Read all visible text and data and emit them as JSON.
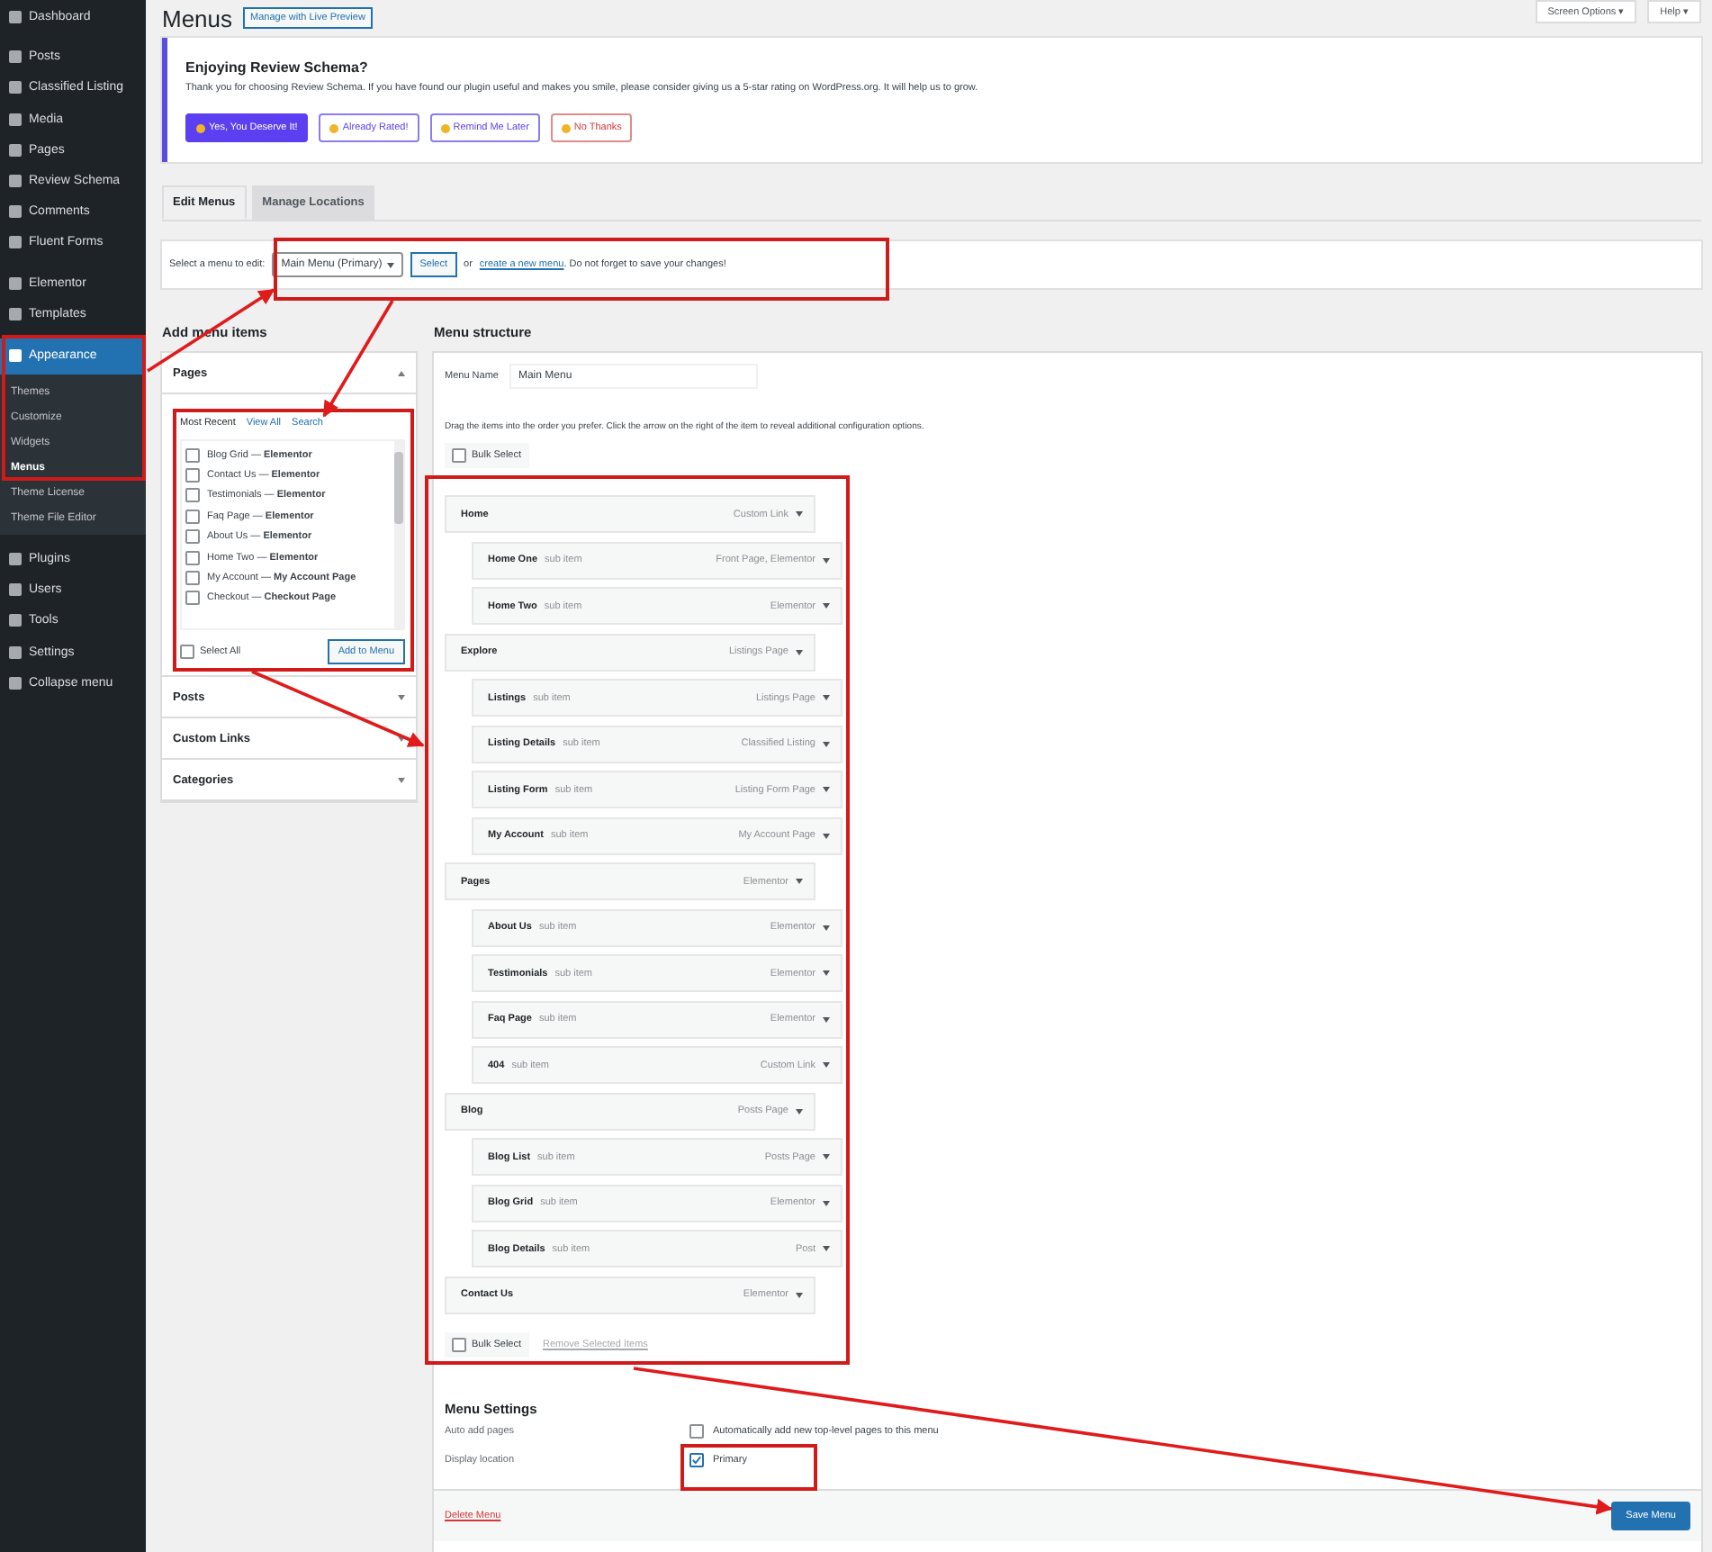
{
  "sidebar": {
    "items": [
      {
        "label": "Dashboard",
        "selected": false
      },
      {
        "label": "Posts",
        "selected": false
      },
      {
        "label": "Classified Listing",
        "selected": false
      },
      {
        "label": "Media",
        "selected": false
      },
      {
        "label": "Pages",
        "selected": false
      },
      {
        "label": "Review Schema",
        "selected": false
      },
      {
        "label": "Comments",
        "selected": false
      },
      {
        "label": "Fluent Forms",
        "selected": false
      },
      {
        "label": "Elementor",
        "selected": false
      },
      {
        "label": "Templates",
        "selected": false
      },
      {
        "label": "Appearance",
        "selected": true,
        "children": [
          {
            "label": "Themes",
            "selected": false
          },
          {
            "label": "Customize",
            "selected": false
          },
          {
            "label": "Widgets",
            "selected": false
          },
          {
            "label": "Menus",
            "selected": true
          },
          {
            "label": "Theme License",
            "selected": false
          },
          {
            "label": "Theme File Editor",
            "selected": false
          }
        ]
      },
      {
        "label": "Plugins",
        "selected": false
      },
      {
        "label": "Users",
        "selected": false
      },
      {
        "label": "Tools",
        "selected": false
      },
      {
        "label": "Settings",
        "selected": false
      },
      {
        "label": "Collapse menu",
        "selected": false
      }
    ]
  },
  "header": {
    "title": "Menus",
    "live_preview_button": "Manage with Live Preview",
    "top_buttons": [
      "Screen Options ▾",
      "Help ▾"
    ]
  },
  "notice": {
    "title": "Enjoying Review Schema?",
    "text": "Thank you for choosing Review Schema. If you have found our plugin useful and makes you smile, please consider giving us a 5-star rating on WordPress.org. It will help us to grow.",
    "buttons": [
      {
        "label": "Yes, You Deserve It!",
        "kind": "primary"
      },
      {
        "label": "Already Rated!",
        "kind": "outline"
      },
      {
        "label": "Remind Me Later",
        "kind": "outline"
      },
      {
        "label": "No Thanks",
        "kind": "danger"
      }
    ]
  },
  "tabs": [
    {
      "label": "Edit Menus",
      "selected": true
    },
    {
      "label": "Manage Locations",
      "selected": false
    }
  ],
  "select_bar": {
    "label": "Select a menu to edit:",
    "value": "Main Menu (Primary)",
    "button": "Select",
    "or": "or",
    "link": "create a new menu",
    "note": ". Do not forget to save your changes!"
  },
  "add_items": {
    "title": "Add menu items",
    "sections": [
      {
        "label": "Pages",
        "expanded": true
      },
      {
        "label": "Posts",
        "expanded": false
      },
      {
        "label": "Custom Links",
        "expanded": false
      },
      {
        "label": "Categories",
        "expanded": false
      }
    ],
    "page_tabs": [
      {
        "label": "Most Recent",
        "selected": true
      },
      {
        "label": "View All",
        "selected": false
      },
      {
        "label": "Search",
        "selected": false
      }
    ],
    "pages": [
      {
        "label": "Blog Grid — **Elementor**",
        "checked": false
      },
      {
        "label": "Contact Us — **Elementor**",
        "checked": false
      },
      {
        "label": "Testimonials — **Elementor**",
        "checked": false
      },
      {
        "label": "Faq Page — **Elementor**",
        "checked": false
      },
      {
        "label": "About Us — **Elementor**",
        "checked": false
      },
      {
        "label": "Home Two — **Elementor**",
        "checked": false
      },
      {
        "label": "My Account — **My Account Page**",
        "checked": false
      },
      {
        "label": "Checkout — **Checkout Page**",
        "checked": false
      }
    ],
    "select_all": {
      "label": "Select All",
      "checked": false
    },
    "add_button": "Add to Menu"
  },
  "structure": {
    "title": "Menu structure",
    "name_label": "Menu Name",
    "name_value": "Main Menu",
    "instructions": "Drag the items into the order you prefer. Click the arrow on the right of the item to reveal additional configuration options.",
    "bulk_select": {
      "label": "Bulk Select",
      "checked": false
    },
    "bulk_select_bottom": {
      "label": "Bulk Select",
      "checked": false
    },
    "remove_link": "Remove Selected Items",
    "items": [
      {
        "title": "Home",
        "type": "Custom Link",
        "children": [
          {
            "title": "Home One",
            "sub_label": "sub item",
            "type": "Front Page, Elementor"
          },
          {
            "title": "Home Two",
            "sub_label": "sub item",
            "type": "Elementor"
          }
        ]
      },
      {
        "title": "Explore",
        "type": "Listings Page",
        "children": [
          {
            "title": "Listings",
            "sub_label": "sub item",
            "type": "Listings Page"
          },
          {
            "title": "Listing Details",
            "sub_label": "sub item",
            "type": "Classified Listing"
          },
          {
            "title": "Listing Form",
            "sub_label": "sub item",
            "type": "Listing Form Page"
          },
          {
            "title": "My Account",
            "sub_label": "sub item",
            "type": "My Account Page"
          }
        ]
      },
      {
        "title": "Pages",
        "type": "Elementor",
        "children": [
          {
            "title": "About Us",
            "sub_label": "sub item",
            "type": "Elementor"
          },
          {
            "title": "Testimonials",
            "sub_label": "sub item",
            "type": "Elementor"
          },
          {
            "title": "Faq Page",
            "sub_label": "sub item",
            "type": "Elementor"
          },
          {
            "title": "404",
            "sub_label": "sub item",
            "type": "Custom Link"
          }
        ]
      },
      {
        "title": "Blog",
        "type": "Posts Page",
        "children": [
          {
            "title": "Blog List",
            "sub_label": "sub item",
            "type": "Posts Page"
          },
          {
            "title": "Blog Grid",
            "sub_label": "sub item",
            "type": "Elementor"
          },
          {
            "title": "Blog Details",
            "sub_label": "sub item",
            "type": "Post"
          }
        ]
      },
      {
        "title": "Contact Us",
        "type": "Elementor"
      }
    ]
  },
  "settings": {
    "title": "Menu Settings",
    "rows": [
      {
        "label": "Auto add pages",
        "option": "Automatically add new top-level pages to this menu",
        "checked": false
      },
      {
        "label": "Display location",
        "option": "Primary",
        "checked": true
      }
    ]
  },
  "footer": {
    "delete_link": "Delete Menu",
    "save_button": "Save Menu"
  }
}
